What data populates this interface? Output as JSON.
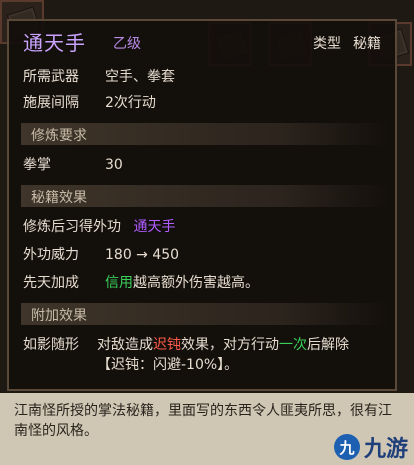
{
  "item": {
    "name": "通天手",
    "grade": "乙级",
    "type_label": "类型",
    "type_value": "秘籍"
  },
  "attributes": [
    {
      "label": "所需武器",
      "value": "空手、拳套"
    },
    {
      "label": "施展间隔",
      "value": "2次行动"
    }
  ],
  "sections": {
    "training": "修炼要求",
    "effects": "秘籍效果",
    "extra": "附加效果"
  },
  "training": {
    "label": "拳掌",
    "value": "30"
  },
  "effects": {
    "learn_label": "修炼后习得外功",
    "learn_value": "通天手",
    "power_label": "外功威力",
    "power_value": "180 → 450",
    "innate_label": "先天加成",
    "innate_highlight": "信用",
    "innate_rest": "越高额外伤害越高。"
  },
  "extra": {
    "label": "如影随形",
    "text_1": "对敌造成",
    "text_2": "迟钝",
    "text_3": "效果，对方行动",
    "text_4": "一次",
    "text_5": "后解除",
    "line2_open": "【",
    "line2_key": "迟钝",
    "line2_rest": "：闪避-10%】。"
  },
  "description": "江南怪所授的掌法秘籍，里面写的东西令人匪夷所思，很有江南怪的风格。",
  "watermark": {
    "logo": "九",
    "text": "九游"
  },
  "colors": {
    "title": "#c9a3ff",
    "highlight_purple": "#b05cff",
    "highlight_green": "#39d05a",
    "highlight_red": "#ff5a4a"
  }
}
